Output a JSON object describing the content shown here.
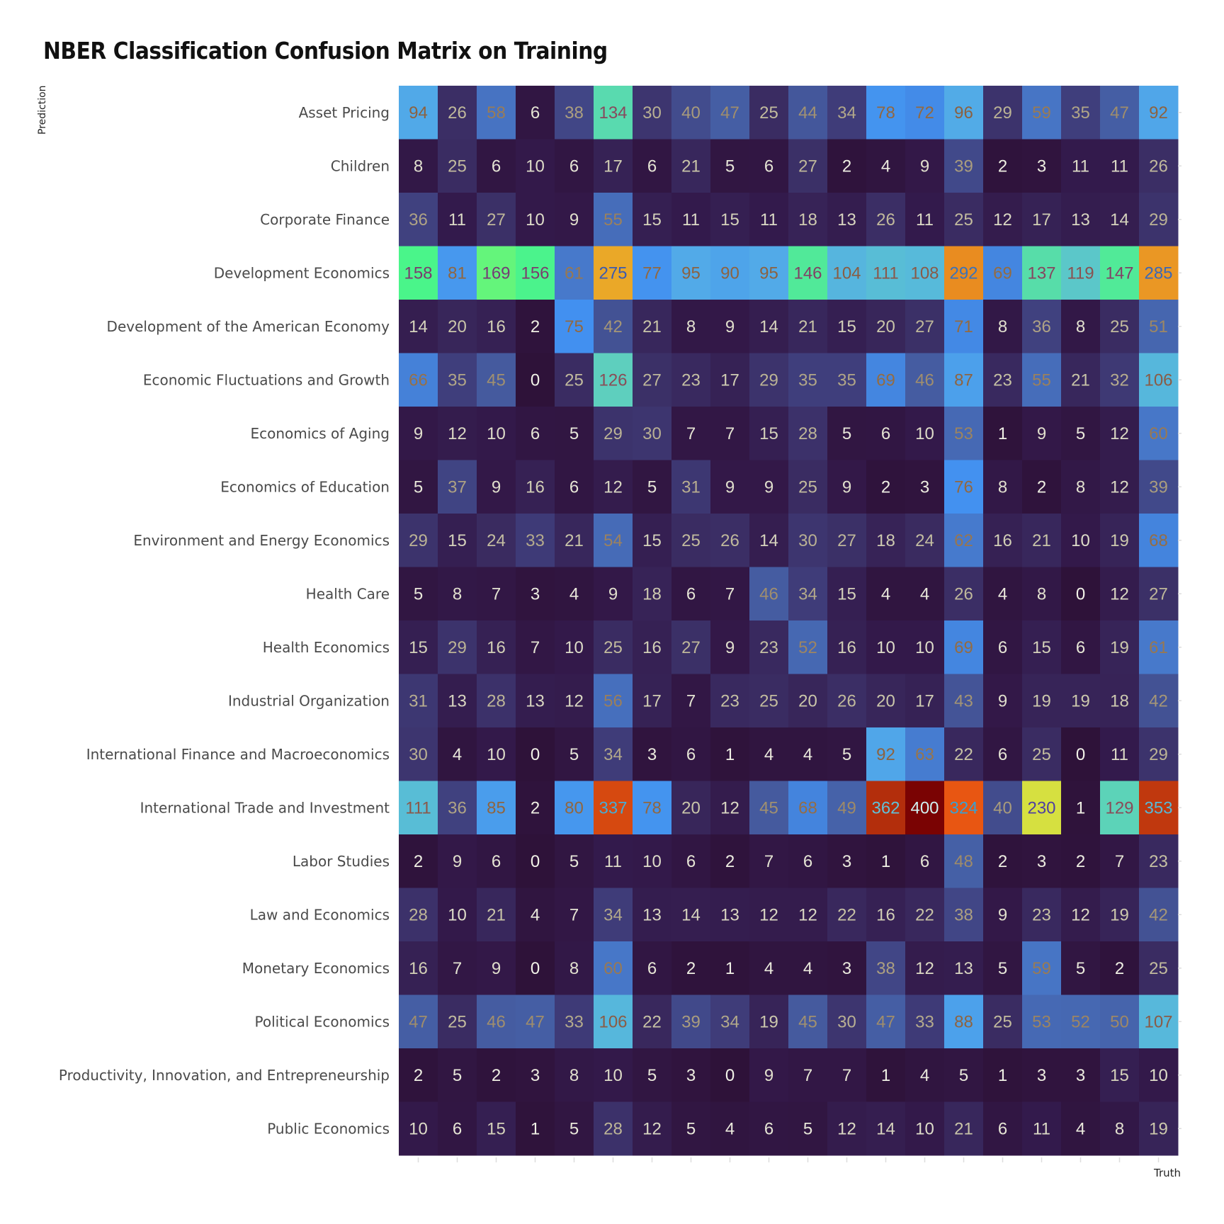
{
  "chart_data": {
    "type": "heatmap",
    "title": "NBER Classification Confusion Matrix on Training",
    "xlabel": "Truth",
    "ylabel": "Prediction",
    "grid": false,
    "legend": "none",
    "x_tick_labels_shown": false,
    "colorscale": "turbo",
    "value_range": [
      0,
      400
    ],
    "rows": [
      "Asset Pricing",
      "Children",
      "Corporate Finance",
      "Development Economics",
      "Development of the American Economy",
      "Economic Fluctuations and Growth",
      "Economics of Aging",
      "Economics of Education",
      "Environment and Energy Economics",
      "Health Care",
      "Health Economics",
      "Industrial Organization",
      "International Finance and Macroeconomics",
      "International Trade and Investment",
      "Labor Studies",
      "Law and Economics",
      "Monetary Economics",
      "Political Economics",
      "Productivity, Innovation, and Entrepreneurship",
      "Public Economics"
    ],
    "values": [
      [
        94,
        26,
        58,
        6,
        38,
        134,
        30,
        40,
        47,
        25,
        44,
        34,
        78,
        72,
        96,
        29,
        59,
        35,
        47,
        92
      ],
      [
        8,
        25,
        6,
        10,
        6,
        17,
        6,
        21,
        5,
        6,
        27,
        2,
        4,
        9,
        39,
        2,
        3,
        11,
        11,
        26
      ],
      [
        36,
        11,
        27,
        10,
        9,
        55,
        15,
        11,
        15,
        11,
        18,
        13,
        26,
        11,
        25,
        12,
        17,
        13,
        14,
        29
      ],
      [
        158,
        81,
        169,
        156,
        61,
        275,
        77,
        95,
        90,
        95,
        146,
        104,
        111,
        108,
        292,
        69,
        137,
        119,
        147,
        285
      ],
      [
        14,
        20,
        16,
        2,
        75,
        42,
        21,
        8,
        9,
        14,
        21,
        15,
        20,
        27,
        71,
        8,
        36,
        8,
        25,
        51
      ],
      [
        66,
        35,
        45,
        0,
        25,
        126,
        27,
        23,
        17,
        29,
        35,
        35,
        69,
        46,
        87,
        23,
        55,
        21,
        32,
        106
      ],
      [
        9,
        12,
        10,
        6,
        5,
        29,
        30,
        7,
        7,
        15,
        28,
        5,
        6,
        10,
        53,
        1,
        9,
        5,
        12,
        60
      ],
      [
        5,
        37,
        9,
        16,
        6,
        12,
        5,
        31,
        9,
        9,
        25,
        9,
        2,
        3,
        76,
        8,
        2,
        8,
        12,
        39
      ],
      [
        29,
        15,
        24,
        33,
        21,
        54,
        15,
        25,
        26,
        14,
        30,
        27,
        18,
        24,
        62,
        16,
        21,
        10,
        19,
        68
      ],
      [
        5,
        8,
        7,
        3,
        4,
        9,
        18,
        6,
        7,
        46,
        34,
        15,
        4,
        4,
        26,
        4,
        8,
        0,
        12,
        27
      ],
      [
        15,
        29,
        16,
        7,
        10,
        25,
        16,
        27,
        9,
        23,
        52,
        16,
        10,
        10,
        69,
        6,
        15,
        6,
        19,
        61
      ],
      [
        31,
        13,
        28,
        13,
        12,
        56,
        17,
        7,
        23,
        25,
        20,
        26,
        20,
        17,
        43,
        9,
        19,
        19,
        18,
        42
      ],
      [
        30,
        4,
        10,
        0,
        5,
        34,
        3,
        6,
        1,
        4,
        4,
        5,
        92,
        63,
        22,
        6,
        25,
        0,
        11,
        29
      ],
      [
        111,
        36,
        85,
        2,
        80,
        337,
        78,
        20,
        12,
        45,
        68,
        49,
        362,
        400,
        324,
        40,
        230,
        1,
        129,
        353
      ],
      [
        2,
        9,
        6,
        0,
        5,
        11,
        10,
        6,
        2,
        7,
        6,
        3,
        1,
        6,
        48,
        2,
        3,
        2,
        7,
        23
      ],
      [
        28,
        10,
        21,
        4,
        7,
        34,
        13,
        14,
        13,
        12,
        12,
        22,
        16,
        22,
        38,
        9,
        23,
        12,
        19,
        42
      ],
      [
        16,
        7,
        9,
        0,
        8,
        60,
        6,
        2,
        1,
        4,
        4,
        3,
        38,
        12,
        13,
        5,
        59,
        5,
        2,
        25
      ],
      [
        47,
        25,
        46,
        47,
        33,
        106,
        22,
        39,
        34,
        19,
        45,
        30,
        47,
        33,
        88,
        25,
        53,
        52,
        50,
        107
      ],
      [
        2,
        5,
        2,
        3,
        8,
        10,
        5,
        3,
        0,
        9,
        7,
        7,
        1,
        4,
        5,
        1,
        3,
        3,
        15,
        10
      ],
      [
        10,
        6,
        15,
        1,
        5,
        28,
        12,
        5,
        4,
        6,
        5,
        12,
        14,
        10,
        21,
        6,
        11,
        4,
        8,
        19
      ]
    ]
  }
}
